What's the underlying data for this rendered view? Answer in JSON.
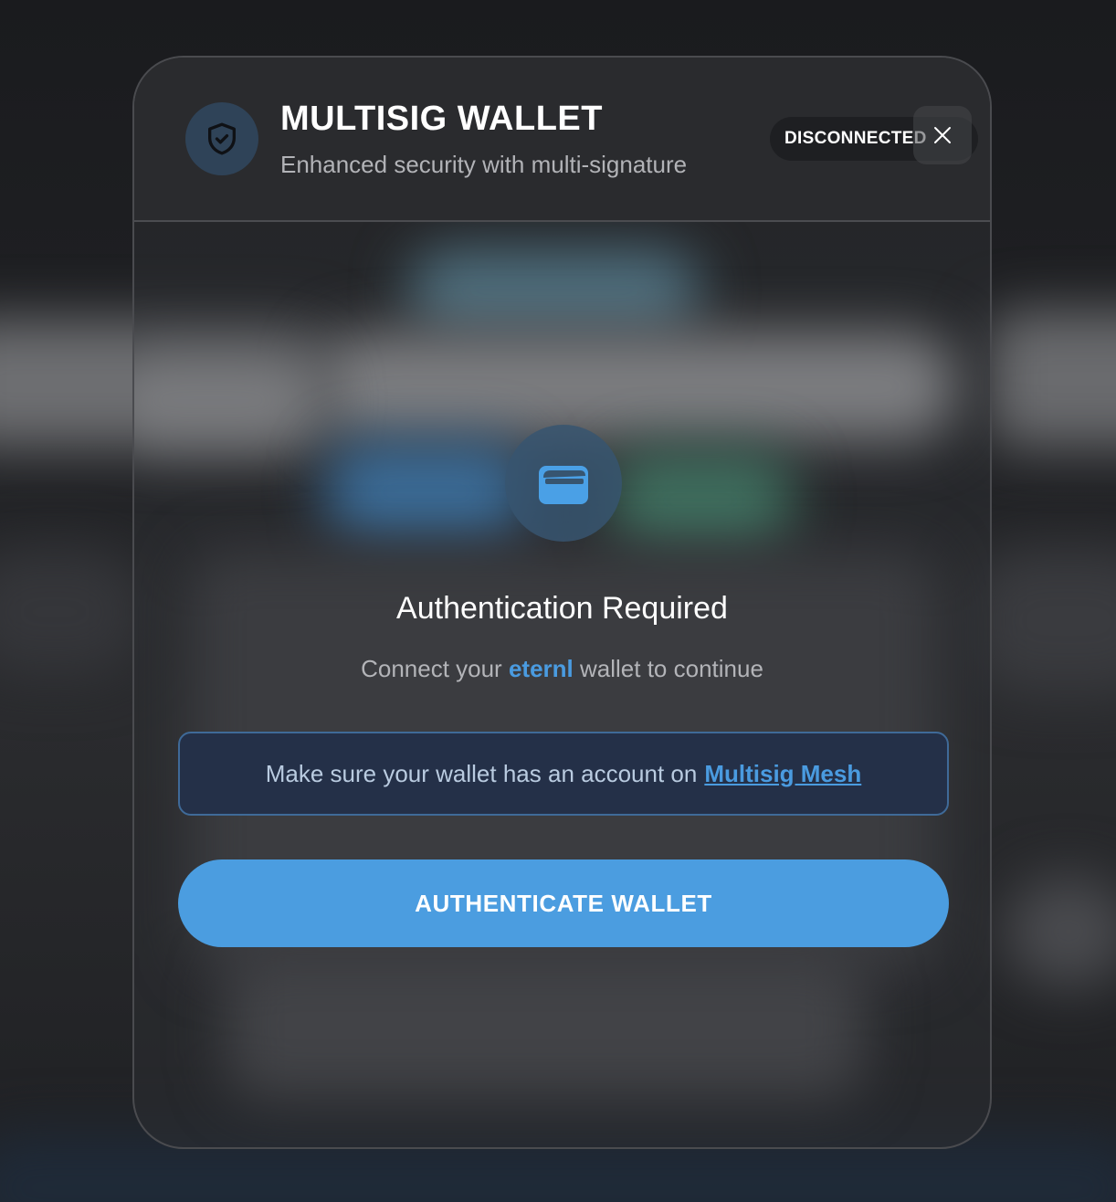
{
  "header": {
    "title": "MULTISIG WALLET",
    "subtitle": "Enhanced security with multi-signature",
    "icon": "shield-check-icon",
    "status": "DISCONNECTED",
    "close_icon": "close-icon"
  },
  "auth": {
    "icon": "wallet-icon",
    "title": "Authentication Required",
    "subtitle_prefix": "Connect your",
    "wallet_name": "eternl",
    "subtitle_suffix": "wallet to continue"
  },
  "notice": {
    "text": "Make sure your wallet has an account on",
    "link_text": "Multisig Mesh"
  },
  "actions": {
    "authenticate_label": "AUTHENTICATE WALLET"
  },
  "colors": {
    "accent": "#4b9de0",
    "brand_text": "#4a9be0",
    "notice_border": "#3f6a98",
    "notice_bg": "#243048",
    "header_bg": "#2a2b2e"
  }
}
